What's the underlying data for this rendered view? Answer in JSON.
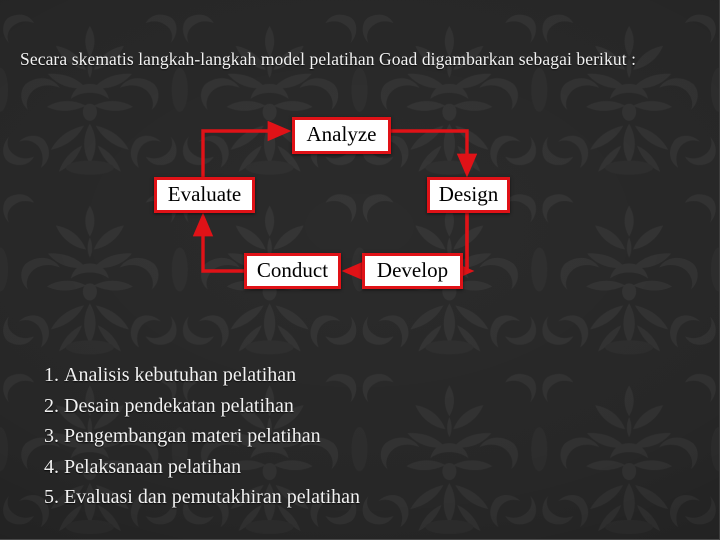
{
  "slide": {
    "intro_text": "Secara skematis langkah-langkah model pelatihan Goad digambarkan sebagai berikut :",
    "background_color": "#2b2b2b",
    "accent_color": "#e01217",
    "node_fill_color": "#ffffff",
    "text_color": "#f2f2f2"
  },
  "diagram": {
    "type": "cycle-flowchart",
    "nodes": [
      {
        "id": "analyze",
        "label": "Analyze"
      },
      {
        "id": "design",
        "label": "Design"
      },
      {
        "id": "develop",
        "label": "Develop"
      },
      {
        "id": "conduct",
        "label": "Conduct"
      },
      {
        "id": "evaluate",
        "label": "Evaluate"
      }
    ],
    "edges": [
      {
        "from": "analyze",
        "to": "design"
      },
      {
        "from": "design",
        "to": "develop"
      },
      {
        "from": "develop",
        "to": "conduct"
      },
      {
        "from": "conduct",
        "to": "evaluate"
      },
      {
        "from": "evaluate",
        "to": "analyze"
      }
    ]
  },
  "steps": [
    {
      "number": "1.",
      "text": "Analisis kebutuhan pelatihan"
    },
    {
      "number": "2.",
      "text": "Desain pendekatan pelatihan"
    },
    {
      "number": "3.",
      "text": "Pengembangan materi pelatihan"
    },
    {
      "number": "4.",
      "text": "Pelaksanaan pelatihan"
    },
    {
      "number": "5.",
      "text": "Evaluasi dan pemutakhiran pelatihan"
    }
  ]
}
